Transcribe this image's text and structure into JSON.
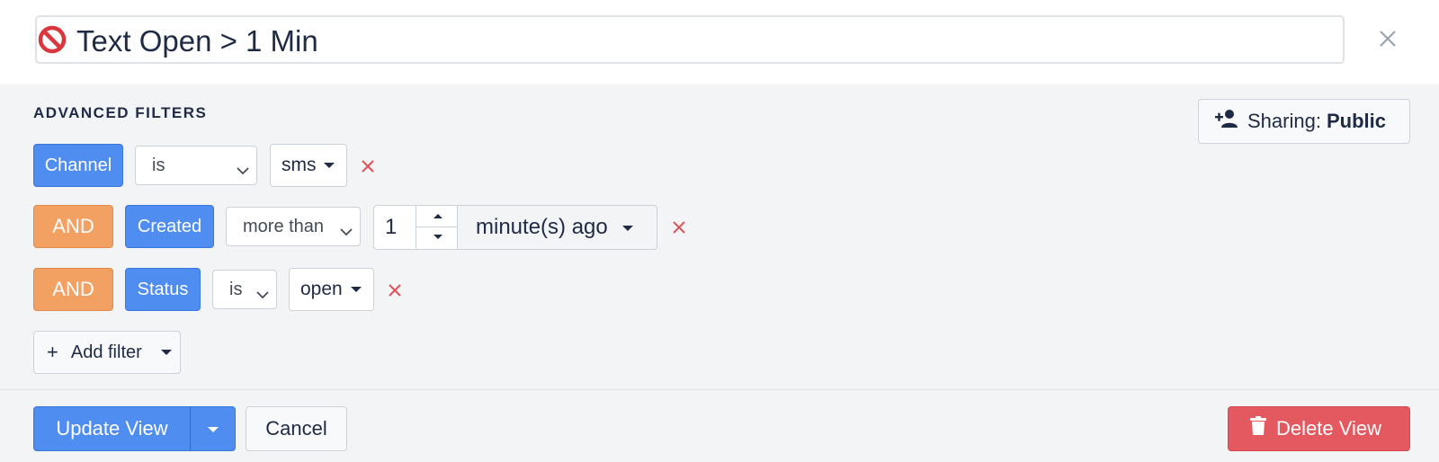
{
  "view": {
    "title": "Text Open > 1 Min",
    "title_icon": "no-entry-icon"
  },
  "filters": {
    "section_title": "ADVANCED FILTERS",
    "sharing": {
      "label": "Sharing:",
      "value": "Public",
      "icon": "add-person-icon"
    },
    "rows": [
      {
        "field": "Channel",
        "operator": "is",
        "value": "sms"
      },
      {
        "conjunction": "AND",
        "field": "Created",
        "operator": "more than",
        "number": "1",
        "unit": "minute(s) ago"
      },
      {
        "conjunction": "AND",
        "field": "Status",
        "operator": "is",
        "value": "open"
      }
    ],
    "add_filter_label": "Add filter",
    "add_filter_plus": "+"
  },
  "footer": {
    "update_label": "Update View",
    "cancel_label": "Cancel",
    "delete_label": "Delete View"
  },
  "colors": {
    "primary": "#4f8df0",
    "conjunction": "#f3a063",
    "danger": "#e3595f",
    "remove_x": "#e0525a"
  }
}
